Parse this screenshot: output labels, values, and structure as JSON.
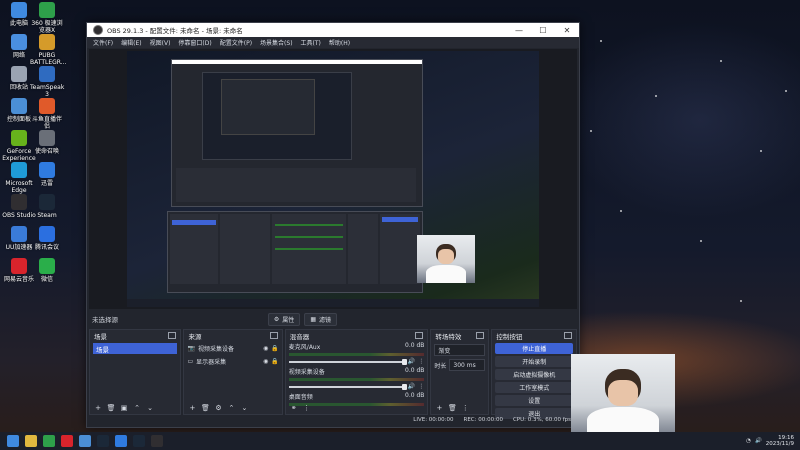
{
  "desktop": {
    "icons": [
      {
        "label": "此电脑",
        "color": "#3f8ae0"
      },
      {
        "label": "360 极速浏览器X",
        "color": "#2ea04a"
      },
      {
        "label": "网络",
        "color": "#4a8fe0"
      },
      {
        "label": "PUBG BATTLEGR...",
        "color": "#d59b2a"
      },
      {
        "label": "回收站",
        "color": "#9aa3b2"
      },
      {
        "label": "TeamSpeak 3",
        "color": "#2f6bc0"
      },
      {
        "label": "控制面板",
        "color": "#4b8fd6"
      },
      {
        "label": "斗鱼直播伴侣",
        "color": "#e05a2a"
      },
      {
        "label": "GeForce Experience",
        "color": "#67b31c"
      },
      {
        "label": "使命召唤",
        "color": "#6a6f78"
      },
      {
        "label": "Microsoft Edge",
        "color": "#1f9bd8"
      },
      {
        "label": "迅雷",
        "color": "#2f7be0"
      },
      {
        "label": "OBS Studio",
        "color": "#302e31"
      },
      {
        "label": "Steam",
        "color": "#1b2838"
      },
      {
        "label": "UU加速器",
        "color": "#3a7bd8"
      },
      {
        "label": "腾讯会议",
        "color": "#2b6fe0"
      },
      {
        "label": "网易云音乐",
        "color": "#d8242c"
      },
      {
        "label": "微信",
        "color": "#2aae4a"
      }
    ]
  },
  "obs": {
    "title": "OBS 29.1.3 - 配置文件: 未命名 - 场景: 未命名",
    "window_controls": [
      "—",
      "☐",
      "✕"
    ],
    "menu": [
      "文件(F)",
      "编辑(E)",
      "视图(V)",
      "停靠窗口(D)",
      "配置文件(P)",
      "场景集合(S)",
      "工具(T)",
      "帮助(H)"
    ],
    "context_bar": {
      "no_source": "未选择源",
      "properties": "属性",
      "filters": "滤镜"
    },
    "scenes": {
      "title": "场景",
      "items": [
        "场景"
      ]
    },
    "sources": {
      "title": "来源",
      "items": [
        {
          "name": "视频采集设备",
          "icon": "camera-icon"
        },
        {
          "name": "显示器采集",
          "icon": "monitor-icon"
        }
      ]
    },
    "mixer": {
      "title": "混音器",
      "channels": [
        {
          "name": "麦克风/Aux",
          "db": "0.0 dB",
          "level": 0.7
        },
        {
          "name": "视频采集设备",
          "db": "0.0 dB",
          "level": 0.7
        },
        {
          "name": "桌面音频",
          "db": "0.0 dB",
          "level": 0.7
        }
      ]
    },
    "transitions": {
      "title": "转场特效",
      "selected": "渐变",
      "duration_label": "时长",
      "duration_value": "300 ms"
    },
    "controls": {
      "title": "控制按钮",
      "buttons": [
        "停止直播",
        "开始录制",
        "启动虚拟摄像机",
        "工作室模式",
        "设置",
        "退出"
      ]
    },
    "status": {
      "live": "LIVE: 00:00:00",
      "rec": "REC: 00:00:00",
      "cpu": "CPU: 0.3%, 60.00 fps"
    }
  },
  "taskbar": {
    "time": "19:16",
    "date": "2023/11/9",
    "apps": [
      "start-icon",
      "file-explorer-icon",
      "chrome-icon",
      "netease-icon",
      "browser-icon",
      "steam-icon",
      "globe-icon",
      "steam-icon",
      "obs-icon"
    ]
  }
}
